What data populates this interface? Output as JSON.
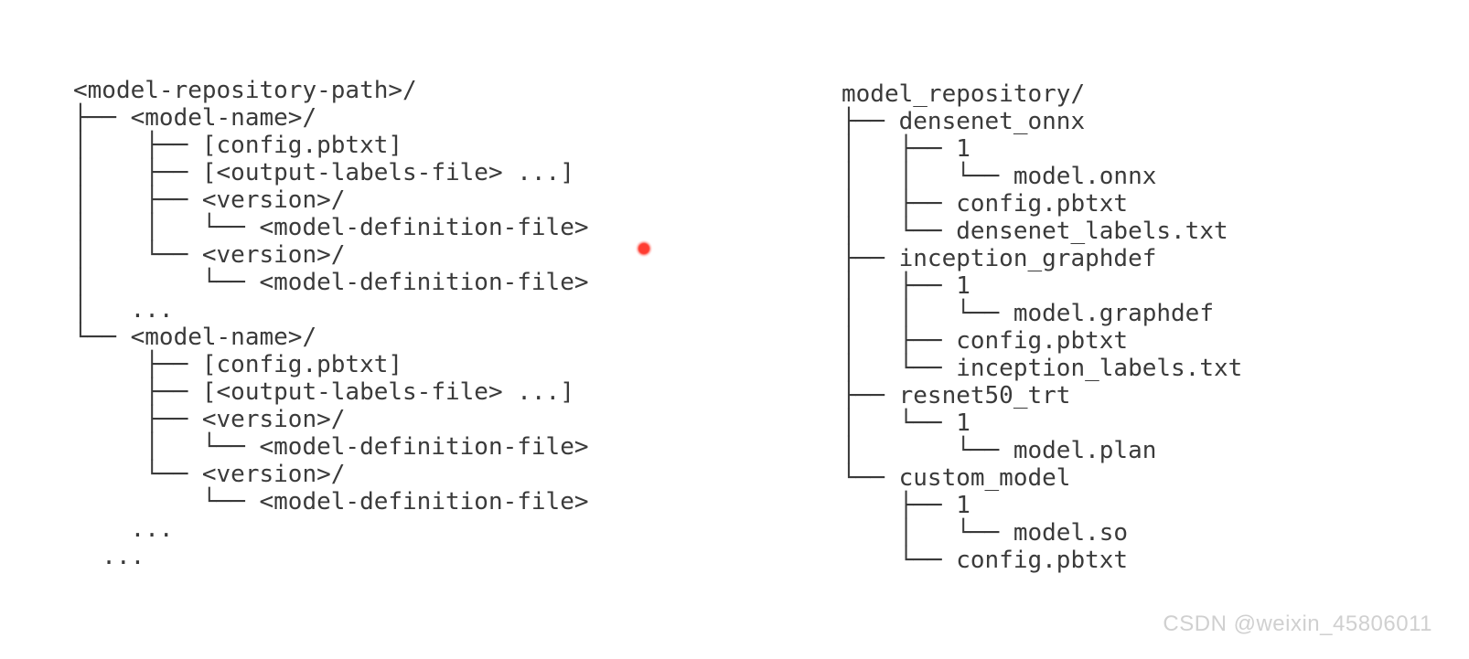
{
  "left_tree": "<model-repository-path>/\n├── <model-name>/\n│    ├── [config.pbtxt]\n│    ├── [<output-labels-file> ...]\n│    ├── <version>/\n│    │   └── <model-definition-file>\n│    └── <version>/\n│        └── <model-definition-file>\n│   ...\n└── <model-name>/\n     ├── [config.pbtxt]\n     ├── [<output-labels-file> ...]\n     ├── <version>/\n     │   └── <model-definition-file>\n     └── <version>/\n         └── <model-definition-file>\n    ...\n  ...",
  "right_tree": "model_repository/\n├── densenet_onnx\n│   ├── 1\n│   │   └── model.onnx\n│   ├── config.pbtxt\n│   └── densenet_labels.txt\n├── inception_graphdef\n│   ├── 1\n│   │   └── model.graphdef\n│   ├── config.pbtxt\n│   └── inception_labels.txt\n├── resnet50_trt\n│   └── 1\n│       └── model.plan\n└── custom_model\n    ├── 1\n    │   └── model.so\n    └── config.pbtxt",
  "watermark": "CSDN @weixin_45806011"
}
